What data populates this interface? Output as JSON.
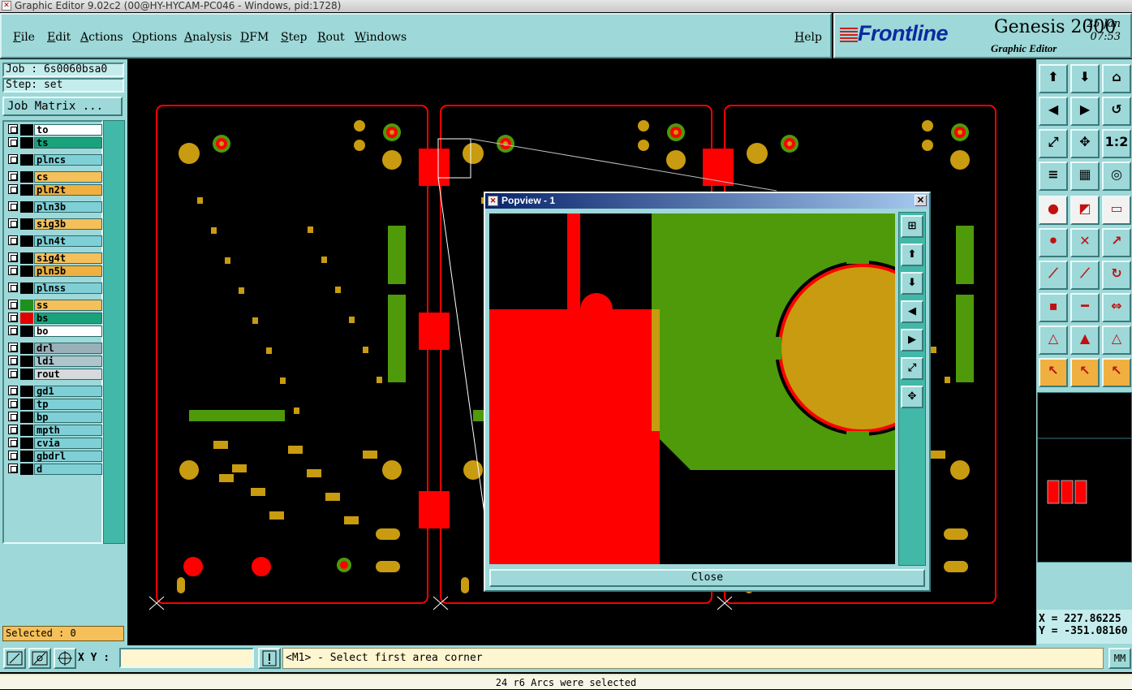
{
  "window": {
    "title": "Graphic Editor 9.02c2 (00@HY-HYCAM-PC046 - Windows, pid:1728)"
  },
  "menu": {
    "items": [
      "File",
      "Edit",
      "Actions",
      "Options",
      "Analysis",
      "DFM",
      "Step",
      "Rout",
      "Windows"
    ],
    "help": "Help"
  },
  "brand": {
    "logo": "Frontline",
    "product": "Genesis 2000",
    "subtitle": "Graphic Editor",
    "date": "25 Jan",
    "time": "07:53"
  },
  "job": {
    "job_label": "Job : 6s0060bsa0",
    "step_label": "Step: set",
    "matrix_button": "Job Matrix ..."
  },
  "layers": [
    {
      "name": "to",
      "bg": "#ffffff",
      "swatch": "#000000"
    },
    {
      "name": "ts",
      "bg": "#1aa37a",
      "swatch": "#000000"
    },
    {
      "name": "plncs",
      "bg": "#7fd0d6",
      "swatch": "#000000"
    },
    {
      "name": "cs",
      "bg": "#f5c05a",
      "swatch": "#000000"
    },
    {
      "name": "pln2t",
      "bg": "#f0b040",
      "swatch": "#000000"
    },
    {
      "name": "pln3b",
      "bg": "#7fd0d6",
      "swatch": "#000000"
    },
    {
      "name": "sig3b",
      "bg": "#f5c05a",
      "swatch": "#000000"
    },
    {
      "name": "pln4t",
      "bg": "#7fd0d6",
      "swatch": "#000000"
    },
    {
      "name": "sig4t",
      "bg": "#f5c05a",
      "swatch": "#000000"
    },
    {
      "name": "pln5b",
      "bg": "#f0b040",
      "swatch": "#000000"
    },
    {
      "name": "plnss",
      "bg": "#7fd0d6",
      "swatch": "#000000"
    },
    {
      "name": "ss",
      "bg": "#f5c05a",
      "swatch": "#1f8f1f"
    },
    {
      "name": "bs",
      "bg": "#1aa37a",
      "swatch": "#e00000"
    },
    {
      "name": "bo",
      "bg": "#ffffff",
      "swatch": "#000000"
    },
    {
      "name": "drl",
      "bg": "#9ab0b8",
      "swatch": "#000000"
    },
    {
      "name": "ldi",
      "bg": "#b0c4cc",
      "swatch": "#000000"
    },
    {
      "name": "rout",
      "bg": "#d6dadc",
      "swatch": "#000000"
    },
    {
      "name": "gd1",
      "bg": "#7fd0d6",
      "swatch": "#000000"
    },
    {
      "name": "tp",
      "bg": "#7fd0d6",
      "swatch": "#000000"
    },
    {
      "name": "bp",
      "bg": "#7fd0d6",
      "swatch": "#000000"
    },
    {
      "name": "mpth",
      "bg": "#7fd0d6",
      "swatch": "#000000"
    },
    {
      "name": "cvia",
      "bg": "#7fd0d6",
      "swatch": "#000000"
    },
    {
      "name": "gbdrl",
      "bg": "#7fd0d6",
      "swatch": "#000000"
    },
    {
      "name": "d",
      "bg": "#7fd0d6",
      "swatch": "#000000"
    }
  ],
  "selected": "Selected : 0",
  "popview": {
    "title": "Popview - 1",
    "close_label": "Close"
  },
  "coords": {
    "x": "X = 227.86225",
    "y": "Y = -351.08160"
  },
  "command": {
    "xy_label": "X Y :",
    "xy_value": "",
    "prompt": "<M1> - Select first area corner",
    "unit": "MM"
  },
  "status": "24 r6 Arcs were selected",
  "colors": {
    "board_green": "#4e9a0a",
    "pad_orange": "#c89b10",
    "copper_red": "#ff0000",
    "panel_cyan": "#9ed8d8"
  }
}
